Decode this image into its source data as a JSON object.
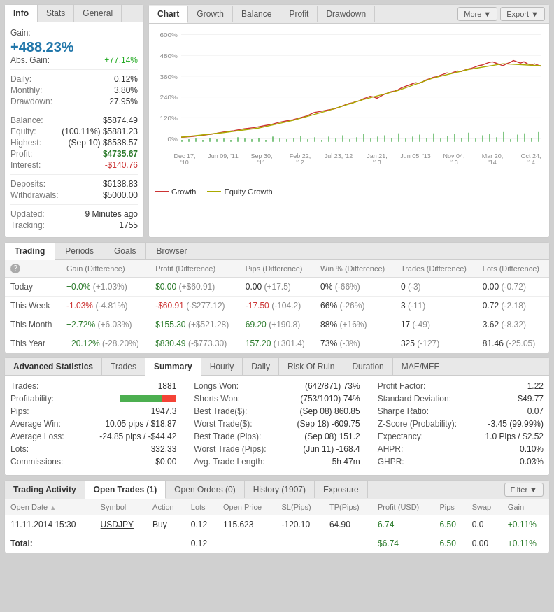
{
  "info": {
    "tabs": [
      "Info",
      "Stats",
      "General"
    ],
    "active_tab": "Info",
    "gain_label": "Gain:",
    "gain_value": "+488.23%",
    "abs_gain_label": "Abs. Gain:",
    "abs_gain_value": "+77.14%",
    "rows": [
      {
        "label": "Daily:",
        "value": "0.12%",
        "class": ""
      },
      {
        "label": "Monthly:",
        "value": "3.80%",
        "class": ""
      },
      {
        "label": "Drawdown:",
        "value": "27.95%",
        "class": ""
      }
    ],
    "rows2": [
      {
        "label": "Balance:",
        "value": "$5874.49",
        "class": ""
      },
      {
        "label": "Equity:",
        "value": "(100.11%) $5881.23",
        "class": ""
      },
      {
        "label": "Highest:",
        "value": "(Sep 10) $6538.57",
        "class": ""
      },
      {
        "label": "Profit:",
        "value": "$4735.67",
        "class": "green"
      },
      {
        "label": "Interest:",
        "value": "-$140.76",
        "class": "red"
      }
    ],
    "rows3": [
      {
        "label": "Deposits:",
        "value": "$6138.83",
        "class": ""
      },
      {
        "label": "Withdrawals:",
        "value": "$5000.00",
        "class": ""
      }
    ],
    "rows4": [
      {
        "label": "Updated:",
        "value": "9 Minutes ago",
        "class": ""
      },
      {
        "label": "Tracking:",
        "value": "1755",
        "class": ""
      }
    ]
  },
  "chart": {
    "tabs": [
      "Chart",
      "Growth",
      "Balance",
      "Profit",
      "Drawdown"
    ],
    "active_tab": "Chart",
    "more_btn": "More ▼",
    "export_btn": "Export ▼",
    "y_labels": [
      "600%",
      "480%",
      "360%",
      "240%",
      "120%",
      "0%"
    ],
    "x_labels": [
      "Dec 17,\n'10",
      "Jun 09, '11",
      "Sep 30,\n'11",
      "Feb 22,\n'12",
      "Jul 23, '12",
      "Jan 21,\n'13",
      "Jun 05, '13",
      "Nov 04,\n'13",
      "Mar 20,\n'14",
      "Oct 24,\n'14"
    ],
    "legend": [
      {
        "label": "Growth",
        "color": "#cc3333"
      },
      {
        "label": "Equity Growth",
        "color": "#aaaa00"
      }
    ]
  },
  "trading": {
    "tabs": [
      "Trading",
      "Periods",
      "Goals",
      "Browser"
    ],
    "active_tab": "Trading",
    "columns": [
      "",
      "Gain (Difference)",
      "Profit (Difference)",
      "Pips (Difference)",
      "Win % (Difference)",
      "Trades (Difference)",
      "Lots (Difference)"
    ],
    "rows": [
      {
        "label": "Today",
        "gain": "+0.0%",
        "gain_diff": "(+1.03%)",
        "gain_class": "green",
        "profit": "$0.00",
        "profit_diff": "(+$60.91)",
        "profit_class": "green",
        "pips": "0.00",
        "pips_diff": "(+17.5)",
        "pips_class": "",
        "win": "0%",
        "win_diff": "(-66%)",
        "win_class": "",
        "trades": "0",
        "trades_diff": "(-3)",
        "lots": "0.00",
        "lots_diff": "(-0.72)"
      },
      {
        "label": "This Week",
        "gain": "-1.03%",
        "gain_diff": "(-4.81%)",
        "gain_class": "red",
        "profit": "-$60.91",
        "profit_diff": "(-$277.12)",
        "profit_class": "red",
        "pips": "-17.50",
        "pips_diff": "(-104.2)",
        "pips_class": "red",
        "win": "66%",
        "win_diff": "(-26%)",
        "win_class": "",
        "trades": "3",
        "trades_diff": "(-11)",
        "lots": "0.72",
        "lots_diff": "(-2.18)"
      },
      {
        "label": "This Month",
        "gain": "+2.72%",
        "gain_diff": "(+6.03%)",
        "gain_class": "green",
        "profit": "$155.30",
        "profit_diff": "(+$521.28)",
        "profit_class": "green",
        "pips": "69.20",
        "pips_diff": "(+190.8)",
        "pips_class": "green",
        "win": "88%",
        "win_diff": "(+16%)",
        "win_class": "",
        "trades": "17",
        "trades_diff": "(-49)",
        "lots": "3.62",
        "lots_diff": "(-8.32)"
      },
      {
        "label": "This Year",
        "gain": "+20.12%",
        "gain_diff": "(-28.20%)",
        "gain_class": "green",
        "profit": "$830.49",
        "profit_diff": "(-$773.30)",
        "profit_class": "green",
        "pips": "157.20",
        "pips_diff": "(+301.4)",
        "pips_class": "green",
        "win": "73%",
        "win_diff": "(-3%)",
        "win_class": "",
        "trades": "325",
        "trades_diff": "(-127)",
        "lots": "81.46",
        "lots_diff": "(-25.05)"
      }
    ]
  },
  "advanced": {
    "section_label": "Advanced Statistics",
    "tabs": [
      "Trades",
      "Summary",
      "Hourly",
      "Daily",
      "Risk Of Ruin",
      "Duration",
      "MAE/MFE"
    ],
    "active_tab": "Summary",
    "col1": [
      {
        "label": "Trades:",
        "value": "1881"
      },
      {
        "label": "Profitability:",
        "value": "bar"
      },
      {
        "label": "Pips:",
        "value": "1947.3"
      },
      {
        "label": "Average Win:",
        "value": "10.05 pips / $18.87"
      },
      {
        "label": "Average Loss:",
        "value": "-24.85 pips / -$44.42"
      },
      {
        "label": "Lots:",
        "value": "332.33"
      },
      {
        "label": "Commissions:",
        "value": "$0.00"
      }
    ],
    "col2": [
      {
        "label": "Longs Won:",
        "value": "(642/871) 73%"
      },
      {
        "label": "Shorts Won:",
        "value": "(753/1010) 74%"
      },
      {
        "label": "Best Trade($):",
        "value": "(Sep 08) 860.85"
      },
      {
        "label": "Worst Trade($):",
        "value": "(Sep 18) -609.75"
      },
      {
        "label": "Best Trade (Pips):",
        "value": "(Sep 08) 151.2"
      },
      {
        "label": "Worst Trade (Pips):",
        "value": "(Jun 11) -168.4"
      },
      {
        "label": "Avg. Trade Length:",
        "value": "5h 47m"
      }
    ],
    "col3": [
      {
        "label": "Profit Factor:",
        "value": "1.22"
      },
      {
        "label": "Standard Deviation:",
        "value": "$49.77"
      },
      {
        "label": "Sharpe Ratio:",
        "value": "0.07"
      },
      {
        "label": "Z-Score (Probability):",
        "value": "-3.45 (99.99%)"
      },
      {
        "label": "Expectancy:",
        "value": "1.0 Pips / $2.52"
      },
      {
        "label": "AHPR:",
        "value": "0.10%"
      },
      {
        "label": "GHPR:",
        "value": "0.03%"
      }
    ]
  },
  "activity": {
    "section_label": "Trading Activity",
    "tabs": [
      "Open Trades (1)",
      "Open Orders (0)",
      "History (1907)",
      "Exposure"
    ],
    "active_tab": "Open Trades (1)",
    "filter_btn": "Filter ▼",
    "columns": [
      "Open Date ▲",
      "Symbol",
      "Action",
      "Lots",
      "Open Price",
      "SL(Pips)",
      "TP(Pips)",
      "Profit (USD)",
      "Pips",
      "Swap",
      "Gain"
    ],
    "rows": [
      {
        "date": "11.11.2014 15:30",
        "symbol": "USDJPY",
        "action": "Buy",
        "lots": "0.12",
        "open_price": "115.623",
        "sl": "-120.10",
        "tp": "64.90",
        "profit": "6.74",
        "pips": "6.50",
        "swap": "0.0",
        "gain": "+0.11%",
        "profit_class": "green",
        "pips_class": "green",
        "gain_class": "green"
      }
    ],
    "total_row": {
      "label": "Total:",
      "lots": "0.12",
      "profit": "$6.74",
      "pips": "6.50",
      "swap": "0.00",
      "gain": "+0.11%"
    }
  }
}
